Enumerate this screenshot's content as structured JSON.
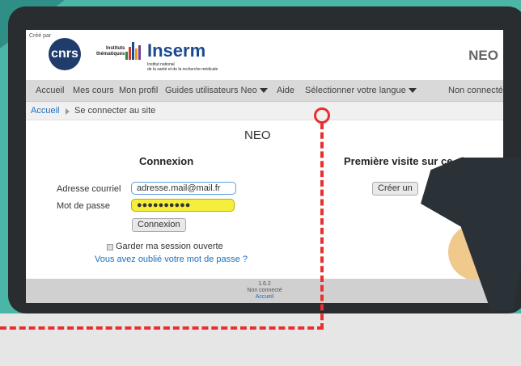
{
  "header": {
    "created_by": "Créé par",
    "cnrs_logo": "cnrs",
    "instituts_line1": "Instituts",
    "instituts_line2": "thématiques",
    "inserm_logo": "Inserm",
    "inserm_sub_line1": "Institut national",
    "inserm_sub_line2": "de la santé et de la recherche médicale",
    "brand": "NEO"
  },
  "nav": {
    "items": [
      {
        "label": "Accueil"
      },
      {
        "label": "Mes cours"
      },
      {
        "label": "Mon profil"
      },
      {
        "label": "Guides utilisateurs Neo"
      },
      {
        "label": "Aide"
      },
      {
        "label": "Sélectionner votre langue"
      }
    ],
    "status": "Non connecté"
  },
  "breadcrumb": {
    "home": "Accueil",
    "current": "Se connecter au site"
  },
  "page_title": "NEO",
  "login": {
    "heading": "Connexion",
    "email_label": "Adresse courriel",
    "email_value": "adresse.mail@mail.fr",
    "password_label": "Mot de passe",
    "password_value": "●●●●●●●●●●",
    "submit_label": "Connexion",
    "remember_label": "Garder ma session ouverte",
    "forgot_link": "Vous avez oublié votre mot de passe ?"
  },
  "first_visit": {
    "heading": "Première visite sur ce site",
    "create_button": "Créer un"
  },
  "footer": {
    "version": "1.6.2",
    "status": "Non connecté",
    "home_link": "Accueil"
  },
  "colors": {
    "background_teal": "#4bb6a8",
    "monitor": "#2a2d30",
    "accent_link": "#1a6fc0",
    "password_highlight": "#f4ef3c",
    "pointer_marker": "#e83030"
  }
}
